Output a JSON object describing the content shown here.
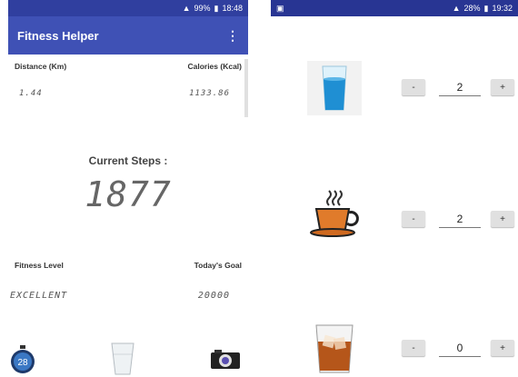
{
  "left": {
    "status": {
      "battery": "99%",
      "time": "18:48"
    },
    "app_title": "Fitness Helper",
    "menu_icon": "overflow-menu-icon",
    "distance_label": "Distance (Km)",
    "calories_label": "Calories (Kcal)",
    "distance_value": "1.44",
    "calories_value": "1133.86",
    "current_steps_label": "Current Steps :",
    "steps_value": "1877",
    "fitness_level_label": "Fitness Level",
    "todays_goal_label": "Today's Goal",
    "fitness_level_value": "EXCELLENT",
    "todays_goal_value": "20000",
    "timer_badge": "28",
    "bottom_icons": [
      "stopwatch-icon",
      "glass-icon",
      "camera-icon"
    ]
  },
  "right": {
    "status": {
      "battery": "28%",
      "time": "19:32"
    },
    "drinks": [
      {
        "icon": "water-glass-icon",
        "minus": "-",
        "qty": "2",
        "plus": "+"
      },
      {
        "icon": "coffee-cup-icon",
        "minus": "-",
        "qty": "2",
        "plus": "+"
      },
      {
        "icon": "whiskey-glass-icon",
        "minus": "-",
        "qty": "0",
        "plus": "+"
      }
    ]
  }
}
